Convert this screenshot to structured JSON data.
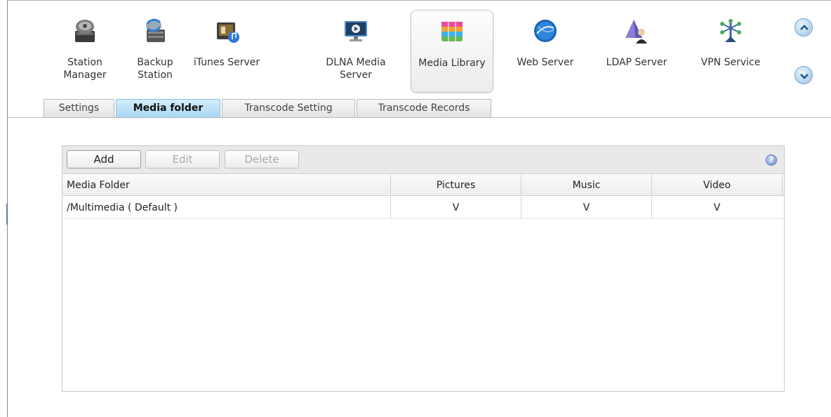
{
  "apps": [
    {
      "label": "Station\nManager",
      "icon": "station-manager-icon"
    },
    {
      "label": "Backup\nStation",
      "icon": "backup-station-icon"
    },
    {
      "label": "iTunes Server",
      "icon": "itunes-server-icon"
    },
    {
      "label": "DLNA Media\nServer",
      "icon": "dlna-media-server-icon"
    },
    {
      "label": "Media Library",
      "icon": "media-library-icon",
      "active": true
    },
    {
      "label": "Web Server",
      "icon": "web-server-icon"
    },
    {
      "label": "LDAP Server",
      "icon": "ldap-server-icon"
    },
    {
      "label": "VPN Service",
      "icon": "vpn-service-icon"
    }
  ],
  "tabs": [
    {
      "label": "Settings"
    },
    {
      "label": "Media folder",
      "active": true
    },
    {
      "label": "Transcode Setting"
    },
    {
      "label": "Transcode Records"
    }
  ],
  "toolbar": {
    "add_label": "Add",
    "edit_label": "Edit",
    "delete_label": "Delete",
    "help_label": "?"
  },
  "table": {
    "columns": [
      "Media Folder",
      "Pictures",
      "Music",
      "Video"
    ],
    "rows": [
      {
        "folder": "/Multimedia ( Default )",
        "pictures": "V",
        "music": "V",
        "video": "V"
      }
    ]
  },
  "colors": {
    "active_tab": "#a8d6f4",
    "accent": "#5a7ab0"
  }
}
